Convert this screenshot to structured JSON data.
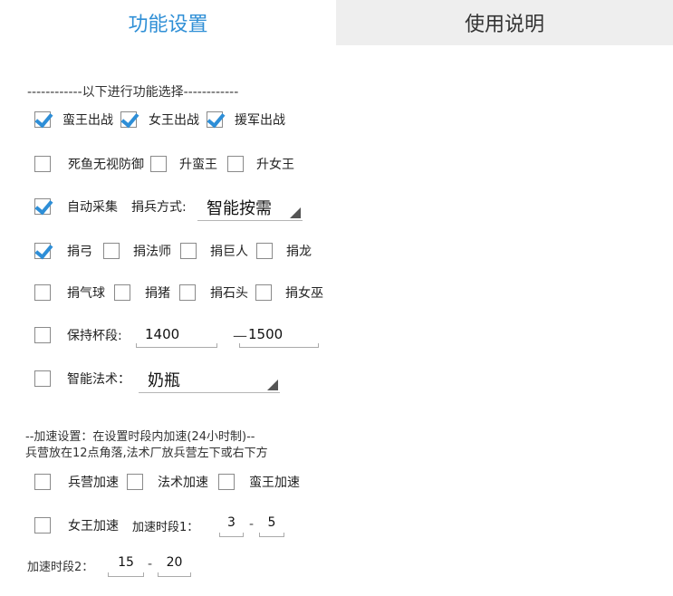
{
  "tabs": {
    "settings": "功能设置",
    "help": "使用说明"
  },
  "colors": {
    "accent": "#2f8fd6"
  },
  "section1_header": "------------以下进行功能选择------------",
  "row1": {
    "king": "蛮王出战",
    "queen": "女王出战",
    "reinforce": "援军出战"
  },
  "row2": {
    "deadfish": "死鱼无视防御",
    "upgrade_king": "升蛮王",
    "upgrade_queen": "升女王"
  },
  "row3": {
    "auto_collect": "自动采集",
    "donate_mode_label": "捐兵方式:",
    "donate_mode_value": "智能按需"
  },
  "row4": {
    "archer": "捐弓",
    "wizard": "捐法师",
    "giant": "捐巨人",
    "dragon": "捐龙"
  },
  "row5": {
    "balloon": "捐气球",
    "hog": "捐猪",
    "golem": "捐石头",
    "witch": "捐女巫"
  },
  "row6": {
    "keep_trophy": "保持杯段:",
    "trophy_min": "1400",
    "sep": "—",
    "trophy_max": "1500"
  },
  "row7": {
    "smart_spell": "智能法术：",
    "spell_value": "奶瓶"
  },
  "accel": {
    "header1": "--加速设置：在设置时段内加速(24小时制)--",
    "header2": "兵营放在12点角落,法术厂放兵营左下或右下方",
    "barracks": "兵营加速",
    "spell_factory": "法术加速",
    "king": "蛮王加速",
    "queen": "女王加速",
    "period1_label": "加速时段1：",
    "p1_start": "3",
    "p1_dash": "-",
    "p1_end": "5",
    "period2_label": "加速时段2：",
    "p2_start": "15",
    "p2_dash": "-",
    "p2_end": "20"
  }
}
